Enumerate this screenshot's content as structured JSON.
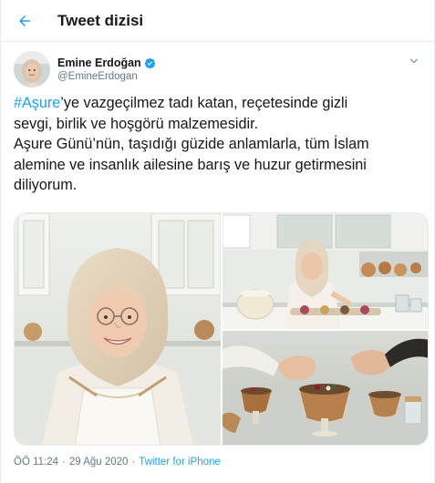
{
  "header": {
    "title": "Tweet dizisi",
    "back_icon": "arrow-left-icon",
    "accent": "#1da1f2"
  },
  "author": {
    "display_name": "Emine Erdoğan",
    "handle": "@EmineErdogan",
    "verified": true,
    "verified_icon": "verified-badge-icon",
    "menu_icon": "chevron-down-icon"
  },
  "tweet": {
    "hashtag": "#Aşure",
    "line1_rest": "’ye vazgeçilmez tadı katan, reçetesinde gizli",
    "line2": "sevgi, birlik ve hoşgörü malzemesidir.",
    "line3": "Aşure Günü’nün, taşıdığı güzide anlamlarla, tüm İslam",
    "line4": "alemine ve insanlık ailesine barış ve huzur getirmesini",
    "line5": "diliyorum."
  },
  "media": {
    "count": 3
  },
  "meta": {
    "time": "ÖÖ 11:24",
    "separator": "·",
    "date": "29 Ağu 2020",
    "source": "Twitter for iPhone"
  }
}
